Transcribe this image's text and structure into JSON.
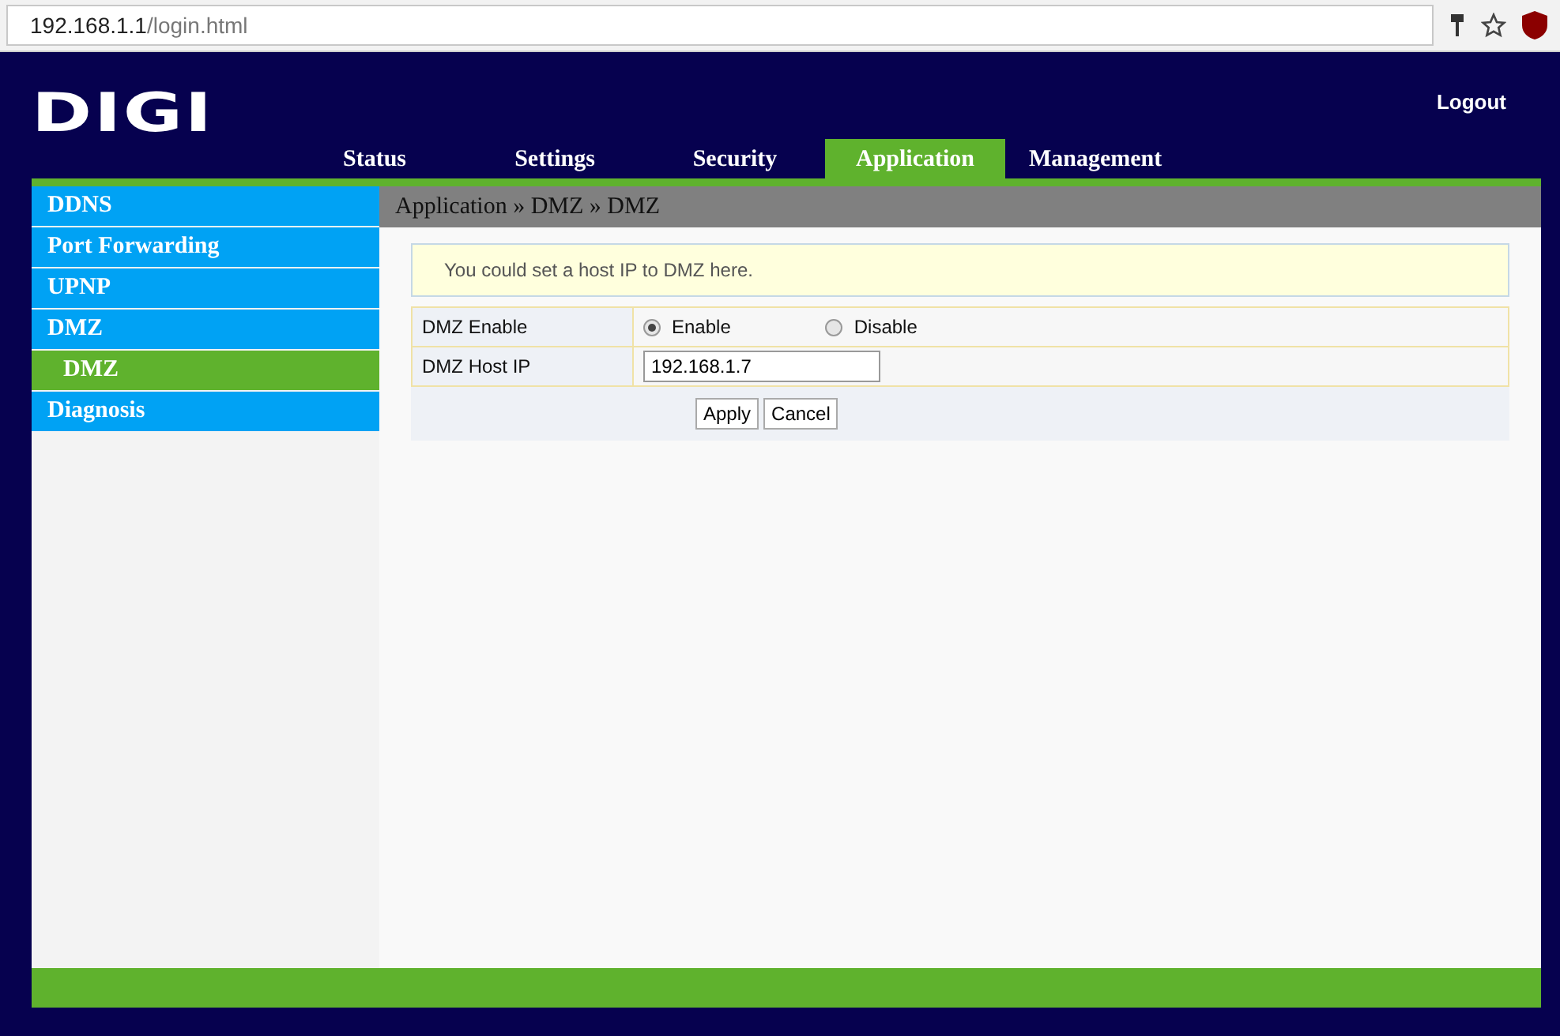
{
  "browser": {
    "url_host": "192.168.1.1",
    "url_path": "/login.html"
  },
  "header": {
    "logo": "DIGI",
    "logout": "Logout"
  },
  "tabs": [
    {
      "label": "Status",
      "selected": false
    },
    {
      "label": "Settings",
      "selected": false
    },
    {
      "label": "Security",
      "selected": false
    },
    {
      "label": "Application",
      "selected": true
    },
    {
      "label": "Management",
      "selected": false
    }
  ],
  "sidebar": {
    "items": [
      {
        "label": "DDNS",
        "selected": false
      },
      {
        "label": "Port Forwarding",
        "selected": false
      },
      {
        "label": "UPNP",
        "selected": false
      },
      {
        "label": "DMZ",
        "selected": false,
        "children": [
          {
            "label": "DMZ",
            "selected": true
          }
        ]
      },
      {
        "label": "Diagnosis",
        "selected": false
      }
    ]
  },
  "breadcrumb": "Application » DMZ » DMZ",
  "notice": "You could set a host IP to DMZ here.",
  "form": {
    "enable_label": "DMZ Enable",
    "options": [
      {
        "label": "Enable",
        "selected": true
      },
      {
        "label": "Disable",
        "selected": false
      }
    ],
    "host_label": "DMZ Host IP",
    "host_value": "192.168.1.7"
  },
  "buttons": [
    "Apply",
    "Cancel"
  ]
}
